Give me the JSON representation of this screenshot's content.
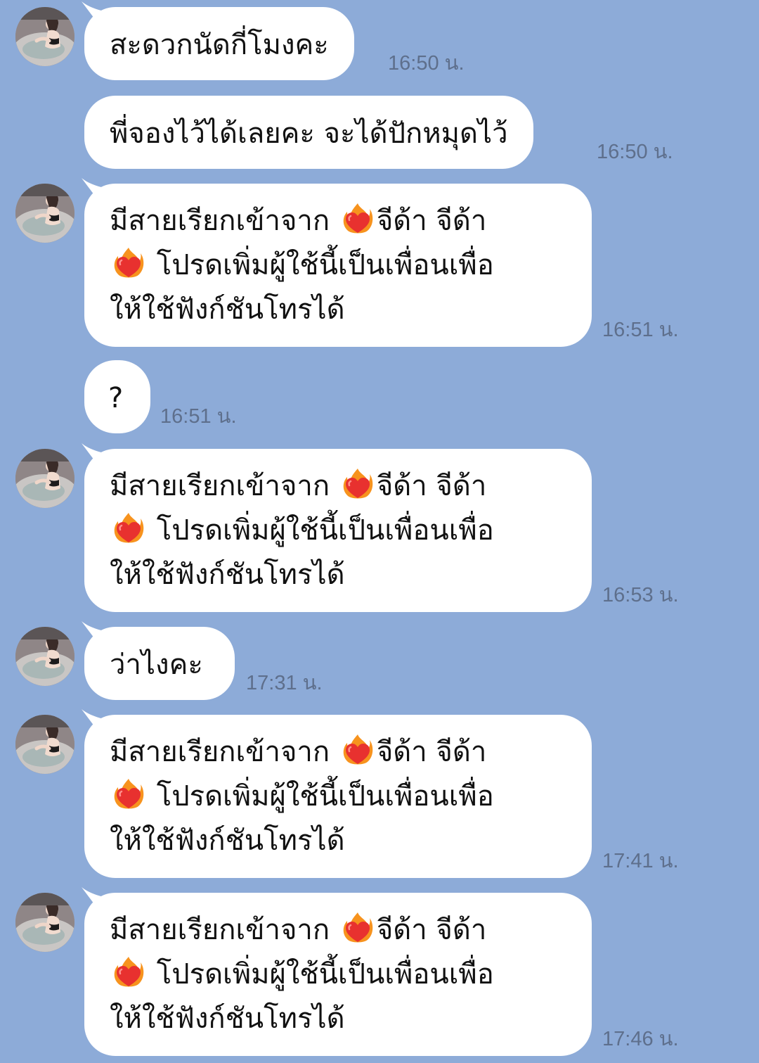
{
  "messages": [
    {
      "text": [
        "สะดวกนัดกี่โมงคะ"
      ],
      "time": "16:50 น."
    },
    {
      "text": [
        "พี่จองไว้ได้เลยคะ จะได้ปักหมุดไว้"
      ],
      "time": "16:50 น."
    },
    {
      "call_notice": {
        "line1_a": "มีสายเรียกเข้าจาก",
        "line1_b": "จีด้า จีด้า",
        "line2": "โปรดเพิ่มผู้ใช้นี้เป็นเพื่อนเพื่อ",
        "line3": "ให้ใช้ฟังก์ชันโทรได้"
      },
      "time": "16:51 น."
    },
    {
      "text": [
        "?"
      ],
      "time": "16:51 น."
    },
    {
      "call_notice": {
        "line1_a": "มีสายเรียกเข้าจาก",
        "line1_b": "จีด้า จีด้า",
        "line2": "โปรดเพิ่มผู้ใช้นี้เป็นเพื่อนเพื่อ",
        "line3": "ให้ใช้ฟังก์ชันโทรได้"
      },
      "time": "16:53 น."
    },
    {
      "text": [
        "ว่าไงคะ"
      ],
      "time": "17:31 น."
    },
    {
      "call_notice": {
        "line1_a": "มีสายเรียกเข้าจาก",
        "line1_b": "จีด้า จีด้า",
        "line2": "โปรดเพิ่มผู้ใช้นี้เป็นเพื่อนเพื่อ",
        "line3": "ให้ใช้ฟังก์ชันโทรได้"
      },
      "time": "17:41 น."
    },
    {
      "call_notice": {
        "line1_a": "มีสายเรียกเข้าจาก",
        "line1_b": "จีด้า จีด้า",
        "line2": "โปรดเพิ่มผู้ใช้นี้เป็นเพื่อนเพื่อ",
        "line3": "ให้ใช้ฟังก์ชันโทรได้"
      },
      "time": "17:46 น."
    }
  ],
  "icons": {
    "avatar": "contact-avatar-photo",
    "emoji": "heart-on-fire-emoji"
  },
  "colors": {
    "background": "#8dabd8",
    "bubble": "#ffffff",
    "timestamp": "#5e6f8c"
  }
}
